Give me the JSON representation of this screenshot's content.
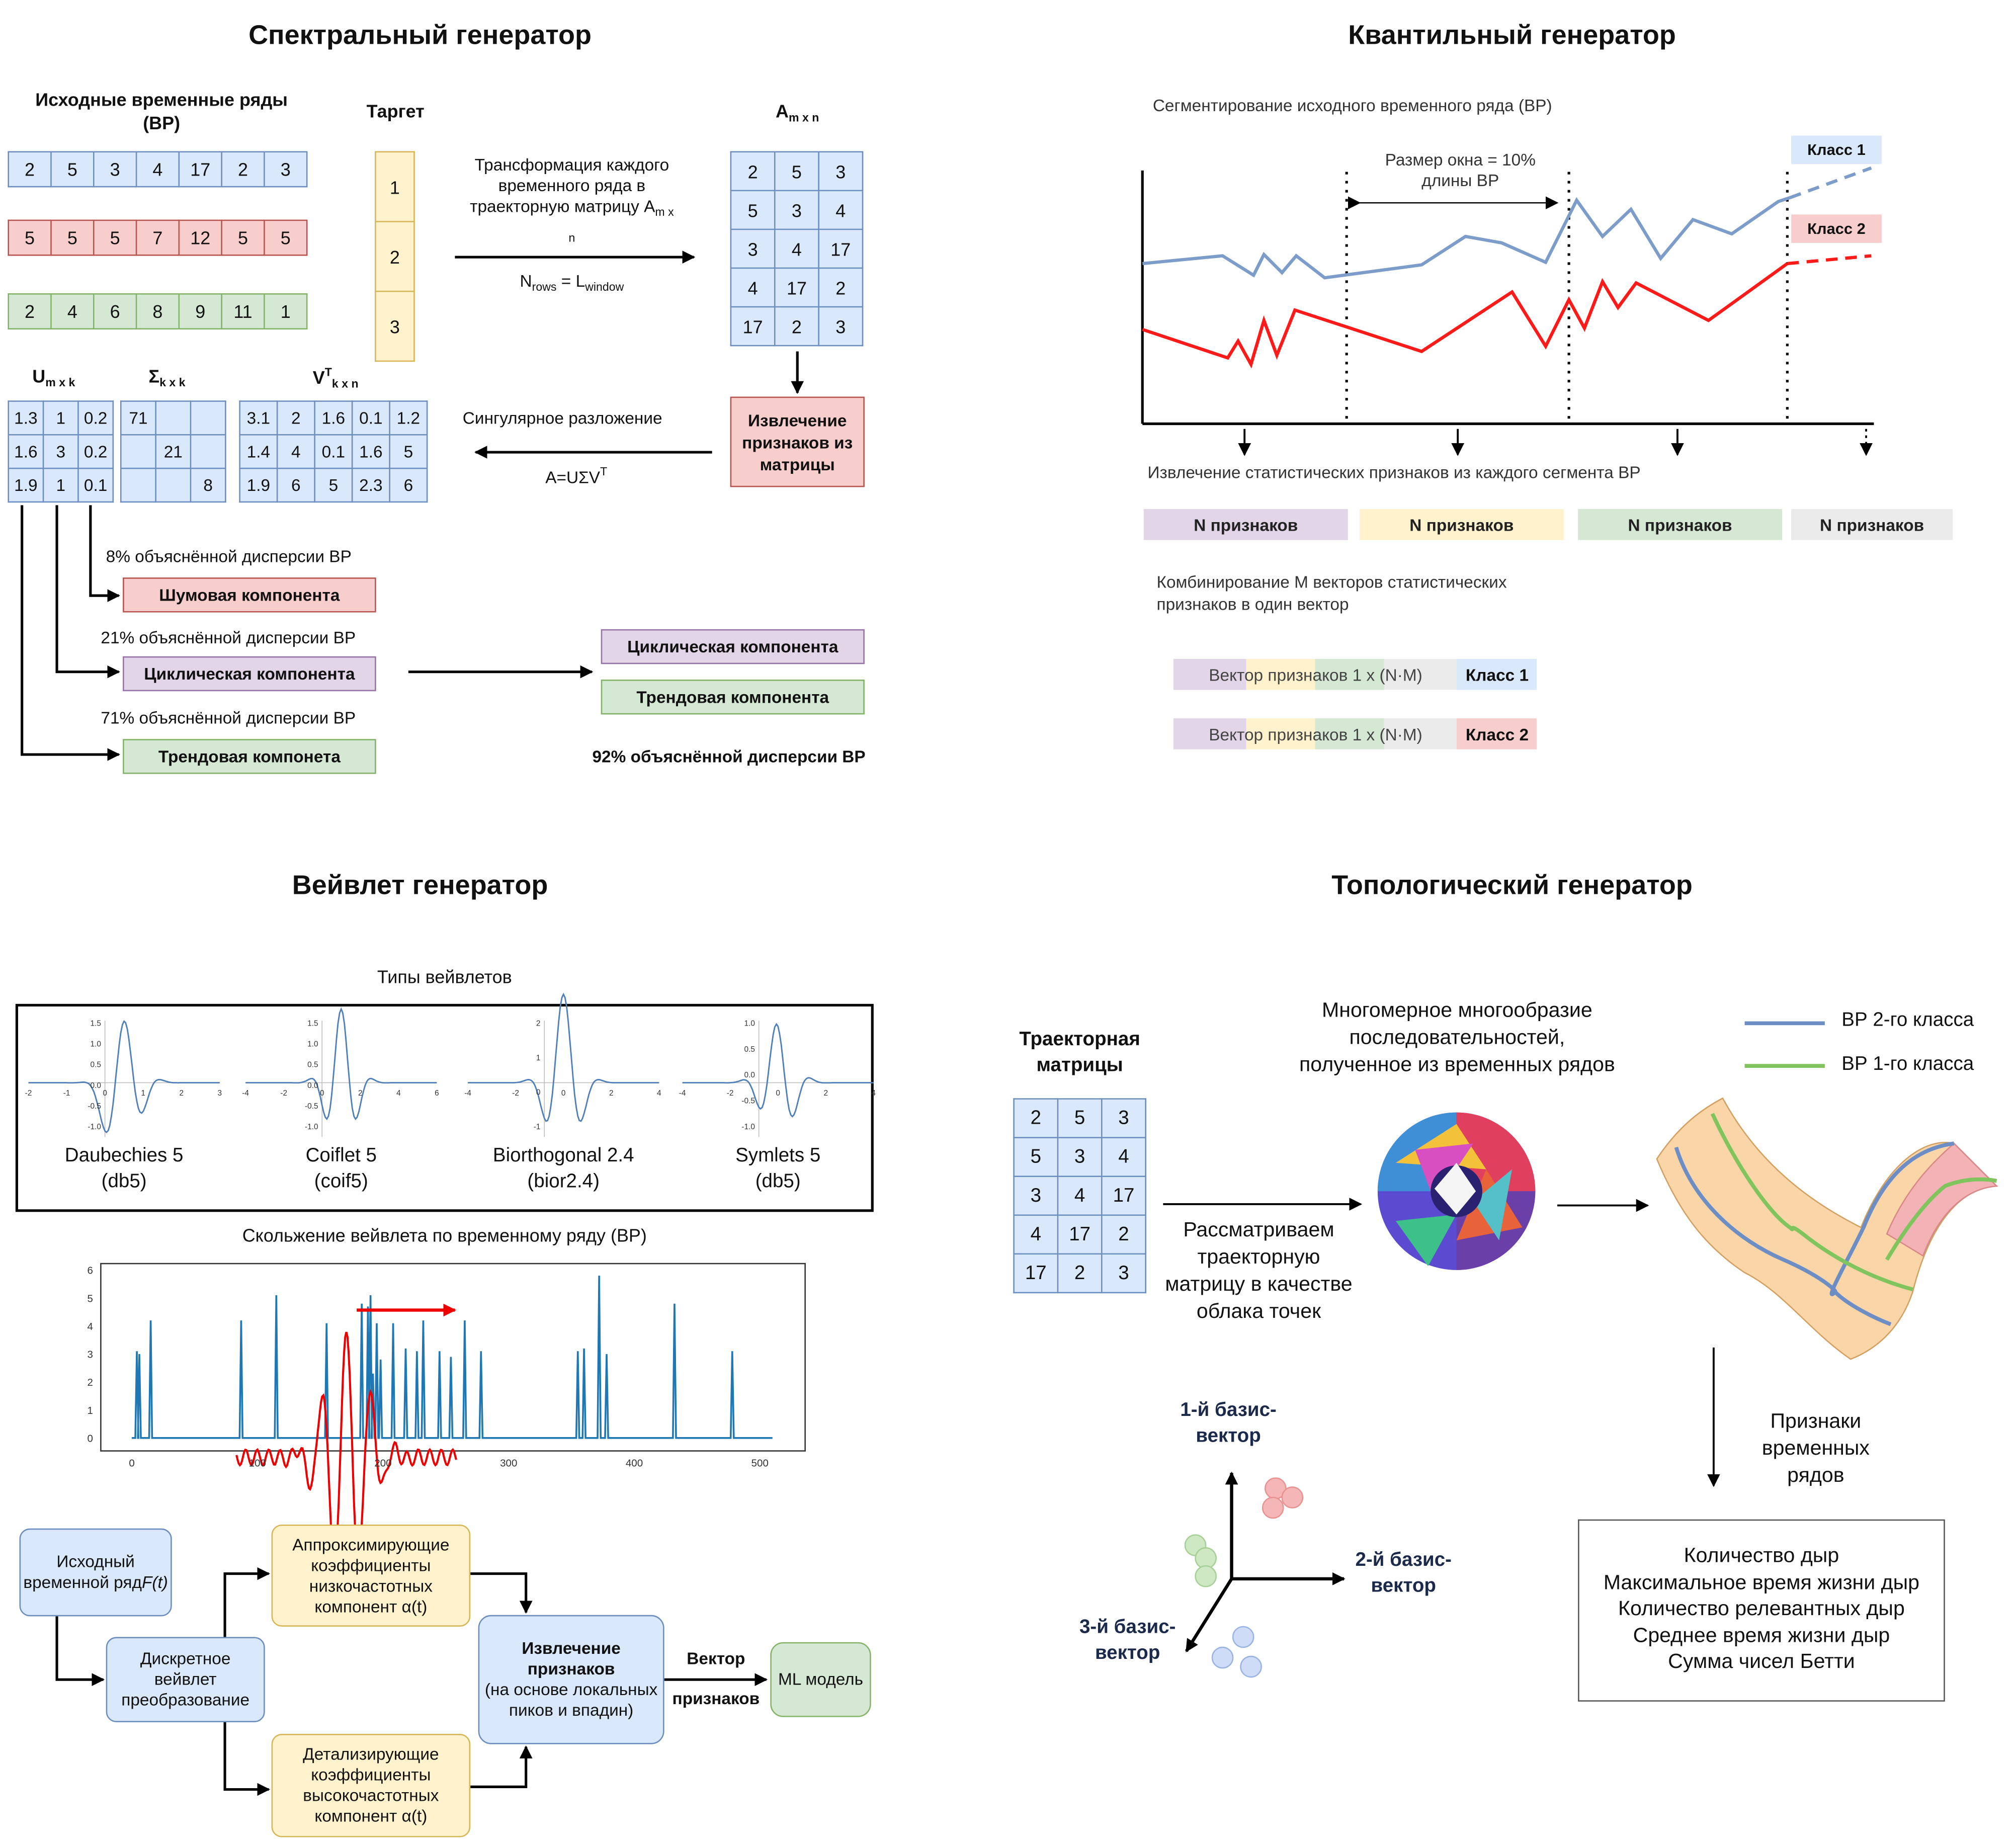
{
  "spectral": {
    "title": "Спектральный генератор",
    "source_label": "Исходные временные ряды (ВР)",
    "target_label": "Таргет",
    "rows": [
      [
        "2",
        "5",
        "3",
        "4",
        "17",
        "2",
        "3"
      ],
      [
        "5",
        "5",
        "5",
        "7",
        "12",
        "5",
        "5"
      ],
      [
        "2",
        "4",
        "6",
        "8",
        "9",
        "11",
        "1"
      ]
    ],
    "target": [
      "1",
      "2",
      "3"
    ],
    "matrix_label_main": "A",
    "matrix_label_sub": "m x n",
    "matrix": [
      [
        "2",
        "5",
        "3"
      ],
      [
        "5",
        "3",
        "4"
      ],
      [
        "3",
        "4",
        "17"
      ],
      [
        "4",
        "17",
        "2"
      ],
      [
        "17",
        "2",
        "3"
      ]
    ],
    "transform_text": "Трансформация каждого временного ряда в траекторную матрицу A",
    "transform_sub": "m x n",
    "nrows_main": "N",
    "nrows_sub1": "rows",
    "nrows_eq": " = L",
    "nrows_sub2": "window",
    "extract_box": "Извлечение признаков из матрицы",
    "svd_text": "Сингулярное разложение",
    "svd_formula": "A=UΣV",
    "svd_sup": "T",
    "u_main": "U",
    "u_sub": "m x k",
    "s_main": "Σ",
    "s_sub": "k x k",
    "v_main": "V",
    "v_sup": "T",
    "v_sub": "k x n",
    "u": [
      [
        "1.3",
        "1",
        "0.2"
      ],
      [
        "1.6",
        "3",
        "0.2"
      ],
      [
        "1.9",
        "1",
        "0.1"
      ]
    ],
    "sigma": [
      [
        "71",
        "",
        ""
      ],
      [
        "",
        "21",
        ""
      ],
      [
        "",
        "",
        "8"
      ]
    ],
    "vt": [
      [
        "3.1",
        "2",
        "1.6",
        "0.1",
        "1.2"
      ],
      [
        "1.4",
        "4",
        "0.1",
        "1.6",
        "5"
      ],
      [
        "1.9",
        "6",
        "5",
        "2.3",
        "6"
      ]
    ],
    "var8": "8% объяснённой дисперсии ВР",
    "noise": "Шумовая компонента",
    "var21": "21% объяснённой дисперсии ВР",
    "cyclic": "Циклическая компонента",
    "var71": "71% объяснённой дисперсии ВР",
    "trend": "Трендовая компонета",
    "cyclic2": "Циклическая компонента",
    "trend2": "Трендовая компонента",
    "var92": "92% объяснённой дисперсии ВР",
    "colors": {
      "blue": "#dae8fc",
      "red": "#f8cecc",
      "green": "#d5e8d4",
      "yellow": "#fff2cc",
      "purple": "#e1d5e7"
    }
  },
  "quantile": {
    "title": "Квантильный генератор",
    "segment_text": "Сегментирование исходного временного ряда (ВР)",
    "window_text": "Размер окна = 10% длины ВР",
    "class1": "Класс 1",
    "class2": "Класс 2",
    "extract_text": "Извлечение статистических признаков из каждого сегмента ВР",
    "features": [
      "N признаков",
      "N признаков",
      "N признаков",
      "N признаков"
    ],
    "combine_text": "Комбинирование M векторов статистических признаков в один вектор",
    "vector_text": "Вектор признаков 1 x (N·M)",
    "line_colors": {
      "class1": "#7c9cc9",
      "class2": "#ff1a1a"
    }
  },
  "wavelet": {
    "title": "Вейвлет генератор",
    "types_title": "Типы вейвлетов",
    "types": [
      {
        "name": "Daubechies 5",
        "code": "(db5)",
        "xticks": [
          "-2",
          "-1",
          "0",
          "1",
          "2",
          "3"
        ],
        "yticks": [
          "1.5",
          "1.0",
          "0.5",
          "0.0",
          "-0.5",
          "-1.0"
        ]
      },
      {
        "name": "Coiflet 5",
        "code": "(coif5)",
        "xticks": [
          "-4",
          "-2",
          "0",
          "2",
          "4",
          "6"
        ],
        "yticks": [
          "1.5",
          "1.0",
          "0.5",
          "0.0",
          "-0.5",
          "-1.0"
        ]
      },
      {
        "name": "Biorthogonal 2.4",
        "code": "(bior2.4)",
        "xticks": [
          "-4",
          "-2",
          "0",
          "2",
          "4"
        ],
        "yticks": [
          "2",
          "1",
          "0",
          "-1"
        ]
      },
      {
        "name": "Symlets 5",
        "code": "(db5)",
        "xticks": [
          "-4",
          "-2",
          "0",
          "2",
          "4"
        ],
        "yticks": [
          "1.0",
          "0.5",
          "0.0",
          "-0.5",
          "-1.0"
        ]
      }
    ],
    "slide_title": "Скольжение вейвлета по временному ряду (ВР)",
    "yticks": [
      "0",
      "1",
      "2",
      "3",
      "4",
      "5",
      "6"
    ],
    "xticks": [
      "0",
      "100",
      "200",
      "300",
      "400",
      "500"
    ],
    "source_box": "Исходный временной ряд",
    "source_fn": "F(t)",
    "dwt_box": "Дискретное вейвлет преобразование",
    "approx_box": "Аппроксимирующие коэффициенты низкочастотных компонент α(t)",
    "detail_box": "Детализирующие коэффициенты высокочастотных компонент α(t)",
    "extract_title": "Извлечение признаков",
    "extract_sub": "(на основе локальных пиков и впадин)",
    "vector_label1": "Вектор",
    "vector_label2": "признаков",
    "ml_box": "ML модель"
  },
  "topological": {
    "title": "Топологический генератор",
    "traj_label": "Траекторная матрицы",
    "matrix": [
      [
        "2",
        "5",
        "3"
      ],
      [
        "5",
        "3",
        "4"
      ],
      [
        "3",
        "4",
        "17"
      ],
      [
        "4",
        "17",
        "2"
      ],
      [
        "17",
        "2",
        "3"
      ]
    ],
    "manifold_text": "Многомерное многообразие последовательностей, полученное из временных рядов",
    "legend2": "ВР 2-го класса",
    "legend1": "ВР 1-го класса",
    "point_cloud_text": "Рассматриваем траекторную матрицу в качестве облака точек",
    "axis1": "1-й базис-вектор",
    "axis2": "2-й базис-вектор",
    "axis3": "3-й базис-вектор",
    "features_label": "Признаки временных рядов",
    "features": [
      "Количество дыр",
      "Максимальное время жизни дыр",
      "Количество релевантных дыр",
      "Среднее время жизни дыр",
      "Сумма чисел Бетти"
    ]
  }
}
